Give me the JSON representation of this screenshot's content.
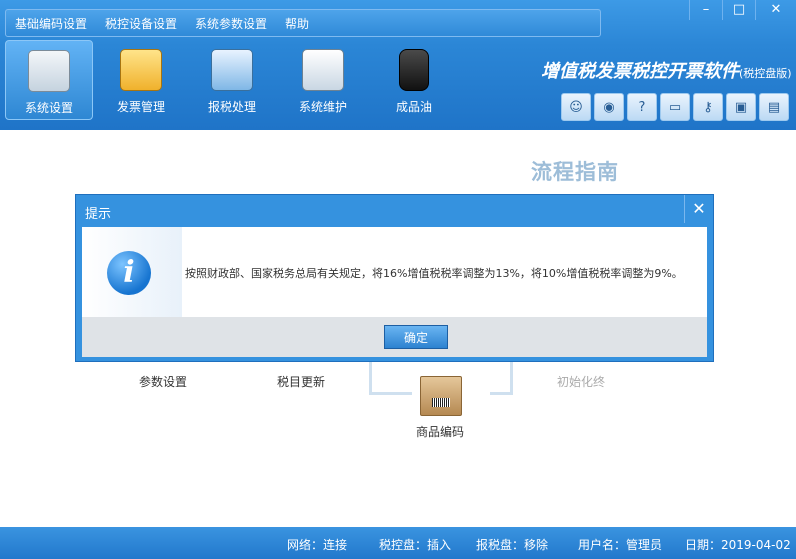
{
  "menu": [
    "基础编码设置",
    "税控设备设置",
    "系统参数设置",
    "帮助"
  ],
  "window_buttons": {
    "minimize": "–",
    "restore": "□",
    "close": "✕"
  },
  "toolbar": [
    {
      "label": "系统设置",
      "icon": "settings-icon",
      "active": true
    },
    {
      "label": "发票管理",
      "icon": "invoice-folder-icon",
      "active": false
    },
    {
      "label": "报税处理",
      "icon": "tax-report-icon",
      "active": false
    },
    {
      "label": "系统维护",
      "icon": "maintenance-tools-icon",
      "active": false
    },
    {
      "label": "成品油",
      "icon": "oil-barrel-icon",
      "active": false
    }
  ],
  "brand": {
    "title": "增值税发票税控开票软件",
    "subtitle": "(税控盘版)"
  },
  "quick_icons": [
    "user-icon",
    "globe-icon",
    "help-icon",
    "window-icon",
    "key-icon",
    "lock-icon",
    "clipboard-icon"
  ],
  "main": {
    "guide_title": "流程指南",
    "flow": {
      "param_setting": "参数设置",
      "tax_catalog_update": "税目更新",
      "product_code": "商品编码",
      "init_done": "初始化终"
    }
  },
  "dialog": {
    "title": "提示",
    "close": "✕",
    "icon": "info-icon",
    "message": "按照财政部、国家税务总局有关规定，将16%增值税税率调整为13%，将10%增值税税率调整为9%。",
    "ok_label": "确定"
  },
  "status": {
    "network": "网络：连接",
    "tax_disk": "税控盘：插入",
    "report_disk": "报税盘：移除",
    "user": "用户名：管理员",
    "date": "日期：2019-04-02"
  },
  "colors": {
    "accent": "#2b86d6",
    "dialog": "#3592df",
    "guide": "#9dbdd8"
  }
}
